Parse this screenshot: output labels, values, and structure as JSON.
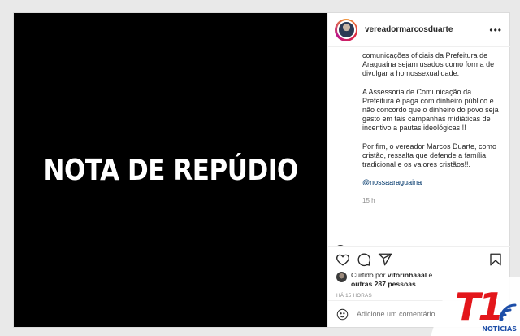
{
  "post": {
    "image_text": "NOTA DE REPÚDIO",
    "username": "vereadormarcosduarte",
    "more_label": "•••",
    "caption_paragraphs": [
      "comunicações oficiais da Prefeitura de Araguaína sejam usados como forma de divulgar a homossexualidade.",
      "A Assessoria de Comunicação da Prefeitura é paga com dinheiro público e não concordo que o dinheiro do povo seja gasto em tais campanhas midiáticas de incentivo a pautas ideológicas !!",
      "Por fim, o vereador Marcos Duarte, como cristão, ressalta que defende a família tradicional e os valores cristãos!!."
    ],
    "mention": "@nossaaraguaina",
    "time": "15 h",
    "likes_prefix": "Curtido por ",
    "likes_user": "vitorinhaaal",
    "likes_mid": " e",
    "likes_others": "outras 287 pessoas",
    "posted_ago": "HÁ 15 HORAS",
    "comment_placeholder": "Adicione um comentário..."
  },
  "watermark": {
    "logo_text": "T1",
    "logo_sub": "NOTÍCIAS",
    "logo_color": "#e3161b"
  }
}
